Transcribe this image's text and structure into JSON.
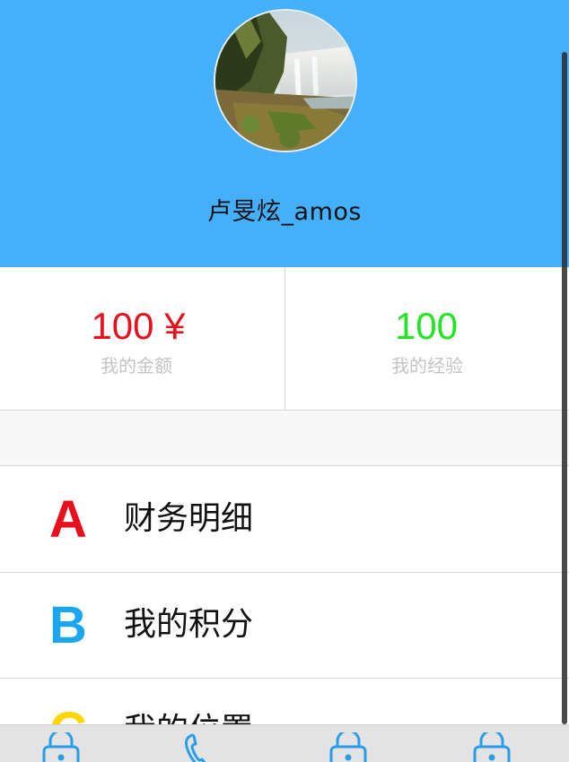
{
  "profile": {
    "username": "卢旻炫_amos"
  },
  "stats": {
    "balance_value": "100 ¥",
    "balance_label": "我的金额",
    "experience_value": "100",
    "experience_label": "我的经验"
  },
  "menu": {
    "items": [
      {
        "letter": "A",
        "label": "财务明细",
        "color": "#e8101c"
      },
      {
        "letter": "B",
        "label": "我的积分",
        "color": "#1aa6f0"
      },
      {
        "letter": "C",
        "label": "我的位置",
        "color": "#ffd600"
      }
    ]
  },
  "tabbar": {
    "icons": [
      "lock-icon",
      "phone-icon",
      "lock-icon",
      "lock-icon"
    ]
  },
  "colors": {
    "header_bg": "#44b0fb",
    "balance": "#e8101c",
    "experience": "#1fe61f",
    "tab_icon": "#2a9de8"
  }
}
